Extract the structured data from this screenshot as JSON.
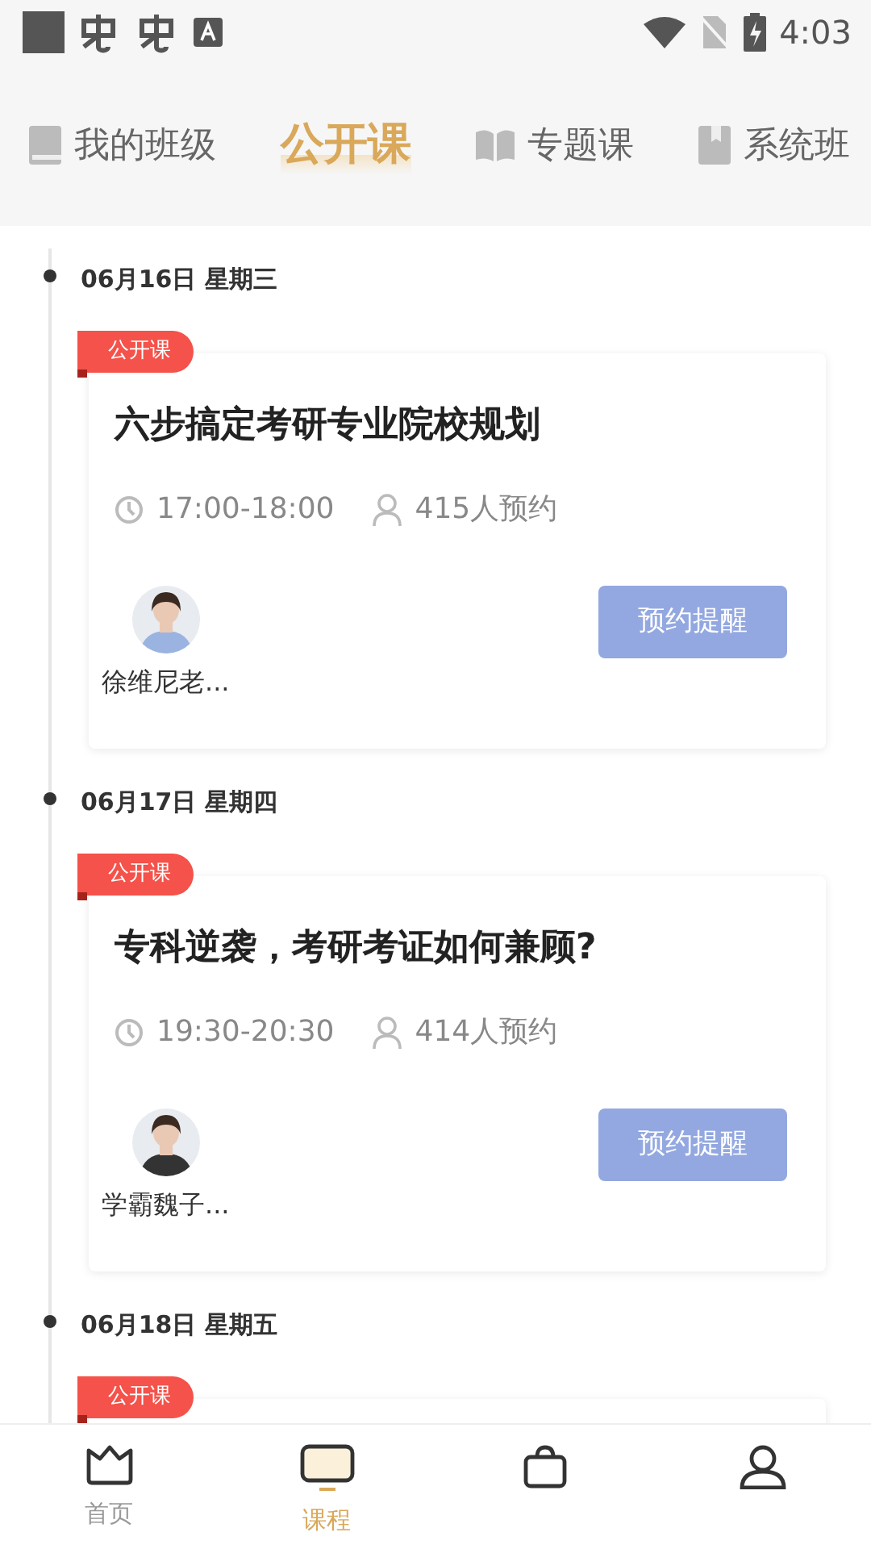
{
  "status_bar": {
    "time": "4:03"
  },
  "top_tabs": [
    {
      "label": "我的班级",
      "selected": false
    },
    {
      "label": "公开课",
      "selected": true
    },
    {
      "label": "专题课",
      "selected": false
    },
    {
      "label": "系统班",
      "selected": false
    }
  ],
  "sessions": [
    {
      "date": "06月16日 星期三",
      "tag": "公开课",
      "title": "六步搞定考研专业院校规划",
      "time": "17:00-18:00",
      "bookings": "415人预约",
      "teacher": "徐维尼老...",
      "button": "预约提醒"
    },
    {
      "date": "06月17日 星期四",
      "tag": "公开课",
      "title": "专科逆袭，考研考证如何兼顾?",
      "time": "19:30-20:30",
      "bookings": "414人预约",
      "teacher": "学霸魏子...",
      "button": "预约提醒"
    },
    {
      "date": "06月18日 星期五",
      "tag": "公开课"
    }
  ],
  "bottom_nav": [
    {
      "label": "首页",
      "selected": false
    },
    {
      "label": "课程",
      "selected": true
    },
    {
      "selected": false
    },
    {
      "selected": false
    }
  ]
}
